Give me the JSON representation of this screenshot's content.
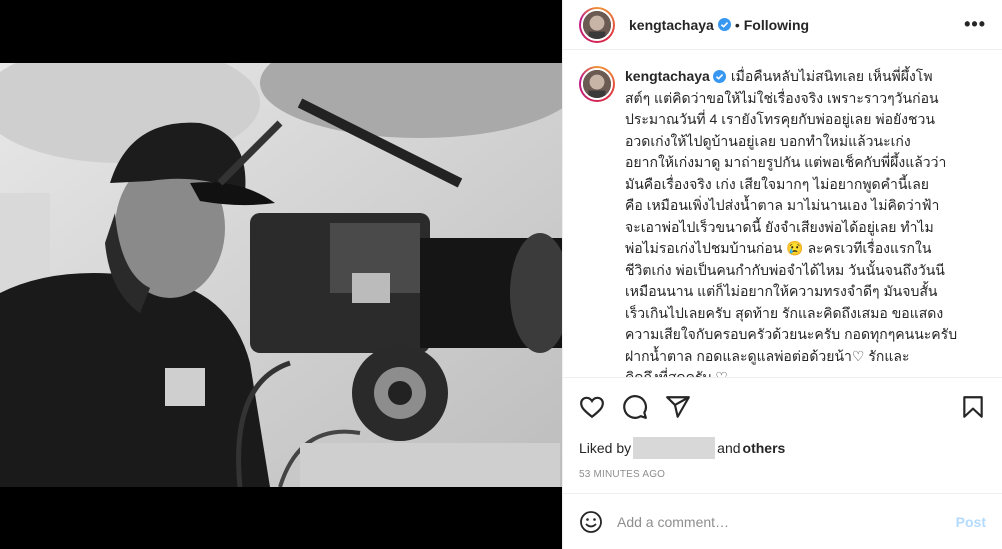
{
  "post": {
    "username": "kengtachaya",
    "separator": "•",
    "follow_status": "Following",
    "more_label": "•••"
  },
  "caption": {
    "username": "kengtachaya",
    "lines": [
      "เมื่อคืนหลับไม่สนิทเลย เห็นพี่ผึ้งโพ",
      "สต์ๆ แต่คิดว่าขอให้ไม่ใช่เรื่องจริง เพราะราวๆวันก่อน",
      "ประมาณวันที่ 4 เรายังโทรคุยกับพ่ออยู่เลย พ่อยังชวน",
      "อวดเก่งให้ไปดูบ้านอยู่เลย บอกทำใหม่แล้วนะเก่ง",
      "อยากให้เก่งมาดู มาถ่ายรูปกัน แต่พอเช็คกับพี่ผึ้งแล้วว่า",
      "มันคือเรื่องจริง เก่ง เสียใจมากๆ ไม่อยากพูดคำนี้เลย",
      "คือ เหมือนเพิ่งไปส่งน้ำตาล มาไม่นานเอง ไม่คิดว่าฟ้า",
      "จะเอาพ่อไปเร็วขนาดนี้ ยังจำเสียงพ่อได้อยู่เลย ทำไม",
      "พ่อไม่รอเก่งไปชมบ้านก่อน 😢 ละครเวทีเรื่องแรกใน",
      "ชีวิตเก่ง พ่อเป็นคนกำกับพ่อจำได้ไหม วันนั้นจนถึงวันนี",
      "เหมือนนาน แต่ก็ไม่อยากให้ความทรงจำดีๆ มันจบสั้น",
      "เร็วเกินไปเลยครับ สุดท้าย รักและคิดถึงเสมอ ขอแสดง",
      "ความเสียใจกับครอบครัวด้วยนะครับ กอดทุกๆคนนะครับ",
      "ฝากน้ำตาล กอดและดูแลพ่อต่อด้วยน้า♡ รักและ",
      "คิดถึงที่สุดครับ ♡"
    ]
  },
  "engagement": {
    "liked_by_prefix": "Liked by",
    "liked_by_connector": "and",
    "others_label": "others",
    "timestamp": "53 MINUTES AGO"
  },
  "comment_box": {
    "placeholder": "Add a comment…",
    "post_label": "Post"
  },
  "icons": {
    "like": "heart-icon",
    "comment": "comment-icon",
    "share": "share-icon",
    "save": "bookmark-icon",
    "emoji": "emoji-icon",
    "verified": "verified-badge-icon"
  },
  "colors": {
    "verified_blue": "#3897f0",
    "post_button": "#b3dbff",
    "muted_text": "#8e8e8e"
  }
}
